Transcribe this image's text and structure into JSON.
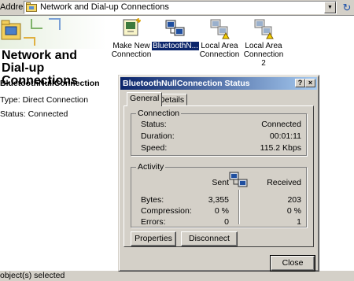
{
  "address_bar": {
    "label": "Address",
    "path": "Network and Dial-up Connections"
  },
  "left_panel": {
    "title": "Network and Dial-up Connections",
    "selected_name": "BluetoothNullConnection",
    "type_line": "Type: Direct Connection",
    "status_line": "Status: Connected"
  },
  "icons": [
    {
      "label_line1": "Make New",
      "label_line2": "Connection"
    },
    {
      "label_line1": "BluetoothN...",
      "label_line2": ""
    },
    {
      "label_line1": "Local Area",
      "label_line2": "Connection"
    },
    {
      "label_line1": "Local Area",
      "label_line2": "Connection 2"
    }
  ],
  "status_bar": {
    "text": "object(s) selected"
  },
  "dialog": {
    "title": "BluetoothNullConnection Status",
    "help_button": "?",
    "close_x": "×",
    "tabs": [
      "General",
      "Details"
    ],
    "connection": {
      "group_title": "Connection",
      "status_label": "Status:",
      "status_value": "Connected",
      "duration_label": "Duration:",
      "duration_value": "00:01:11",
      "speed_label": "Speed:",
      "speed_value": "115.2 Kbps"
    },
    "activity": {
      "group_title": "Activity",
      "sent_label": "Sent",
      "received_label": "Received",
      "bytes_label": "Bytes:",
      "bytes_sent": "3,355",
      "bytes_received": "203",
      "compression_label": "Compression:",
      "compression_sent": "0 %",
      "compression_received": "0 %",
      "errors_label": "Errors:",
      "errors_sent": "0",
      "errors_received": "1"
    },
    "properties_button": "Properties",
    "disconnect_button": "Disconnect",
    "close_button": "Close"
  },
  "colors": {
    "window_face": "#d4d0c8",
    "titlebar_start": "#0a246a",
    "titlebar_end": "#a6caf0",
    "selection": "#0a246a"
  }
}
